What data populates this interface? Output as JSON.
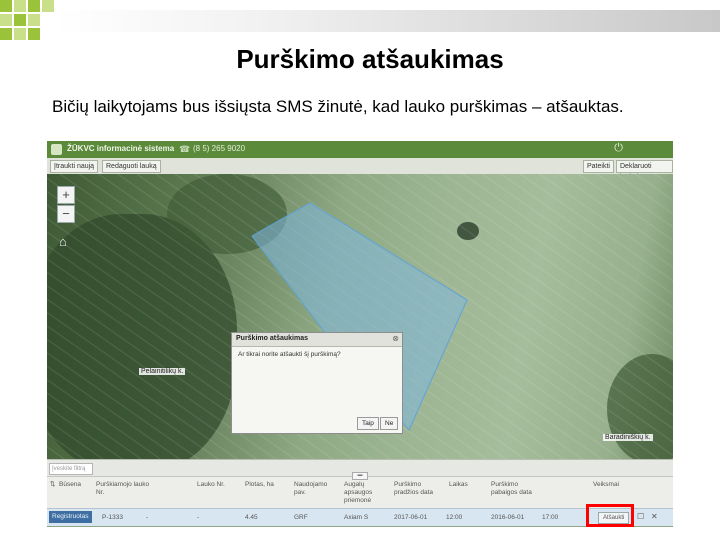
{
  "slide": {
    "title": "Purškimo atšaukimas",
    "subtitle": "Bičių laikytojams bus išsiųsta SMS žinutė, kad lauko purškimas – atšauktas.",
    "colors": {
      "green_dark": "#9ac33a",
      "green_light": "#c9df8a",
      "highlight": "#ff0000"
    }
  },
  "app": {
    "header": {
      "name": "ŽŪKVC informacinė sistema",
      "phone_icon": "phone-icon",
      "phone": "(8 5) 265 9020",
      "power_icon": "power-icon"
    },
    "toolbar": {
      "left_buttons": [
        "Įtraukti naują",
        "Redaguoti lauką"
      ],
      "right_buttons": [
        "Pateikti",
        "Deklaruoti laukai"
      ]
    },
    "map": {
      "zoom_in": "+",
      "zoom_out": "−",
      "home_icon": "home-icon",
      "place_labels": [
        "Pelainitilikų k.",
        "Baradiniškių k."
      ]
    },
    "dialog": {
      "title": "Purškimo atšaukimas",
      "close_icon": "close-icon",
      "question": "Ar tikrai norite atšaukti šį purškimą?",
      "yes": "Taip",
      "no": "Ne"
    },
    "filter": {
      "placeholder": "Įveskite filtrą"
    },
    "table": {
      "columns": [
        "Būsena",
        "Purškiamojo lauko Nr.",
        "Lauko Nr.",
        "Plotas, ha",
        "Naudojamo pav.",
        "Augalų apsaugos priemonė",
        "Purškimo pradžios data",
        "Laikas",
        "Purškimo pabaigos data",
        "Veiksmai"
      ],
      "row": {
        "status_button": "Registruotas",
        "field_no": "P-1333",
        "lauko_no": "-",
        "lauko_no2": "-",
        "area": "4.45",
        "culture": "GRF",
        "product": "Axiam S",
        "start_date": "2017-06-01",
        "time": "12:00",
        "end_date": "2016-06-01",
        "end_time": "17:00",
        "cancel_button": "Atšaukti",
        "edit_icon": "edit-icon",
        "delete_icon": "delete-icon"
      }
    }
  }
}
